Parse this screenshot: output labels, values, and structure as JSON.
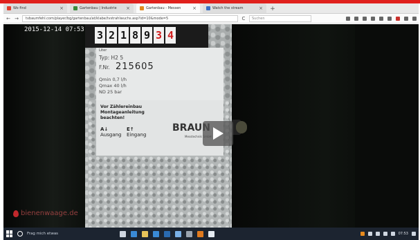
{
  "browser": {
    "tabs": [
      {
        "label": "Wo find",
        "color": "#e23c2c",
        "active": false
      },
      {
        "label": "Gartenbau | Industrie",
        "color": "#3a8a3a",
        "active": false
      },
      {
        "label": "Gartenbau - Messen",
        "color": "#e08a1e",
        "active": true
      },
      {
        "label": "Watch the stream",
        "color": "#3a6fc4",
        "active": false
      }
    ],
    "new_tab": "+",
    "url": "tvbaumfehl.com/player/bg/gartenbau/at/klabe/tvstrahlwuchs.asp?id=10&mode=5",
    "search_placeholder": "Suchen",
    "nav": {
      "back": "←",
      "forward": "→",
      "reload": "C"
    }
  },
  "video": {
    "timestamp": "2015-12-14 07:53",
    "counter_digits": [
      {
        "d": "3",
        "red": false
      },
      {
        "d": "2",
        "red": false
      },
      {
        "d": "1",
        "red": false
      },
      {
        "d": "8",
        "red": false
      },
      {
        "d": "9",
        "red": false
      },
      {
        "d": "3",
        "red": true
      },
      {
        "d": "4",
        "red": true
      }
    ],
    "label": {
      "small_top": "Liter",
      "typ": "Typ: H2 5",
      "fnr_prefix": "F.Nr.",
      "fnr": "215605",
      "qmin": "Qmin 0,7 l/h",
      "qmax": "Qmax 40 l/h",
      "nd": "ND 25 bar",
      "warn1": "Vor Zählereinbau",
      "warn2": "Montageanleitung",
      "warn3": "beachten!",
      "a_code": "A↓",
      "a_label": "Ausgang",
      "e_code": "E↑",
      "e_label": "Eingang",
      "brand": "BRAUN",
      "brand_sub": "Messtechnik GmbH"
    },
    "logo_text": "bienenwaage.de",
    "play_icon": "play-icon"
  },
  "taskbar": {
    "search_text": "Frag mich etwas",
    "apps": [
      {
        "name": "task-view-icon",
        "color": "#cfd6e0"
      },
      {
        "name": "edge-icon",
        "color": "#3a8ad6"
      },
      {
        "name": "explorer-icon",
        "color": "#e6c35a"
      },
      {
        "name": "store-icon",
        "color": "#3a8ad6"
      },
      {
        "name": "mail-icon",
        "color": "#2a6ab0"
      },
      {
        "name": "photos-icon",
        "color": "#7ab0e6"
      },
      {
        "name": "settings-icon",
        "color": "#9aa4b0"
      },
      {
        "name": "firefox-icon",
        "color": "#e07a1e"
      },
      {
        "name": "word-icon",
        "color": "#e6ecf2"
      }
    ],
    "clock": "07:53"
  }
}
